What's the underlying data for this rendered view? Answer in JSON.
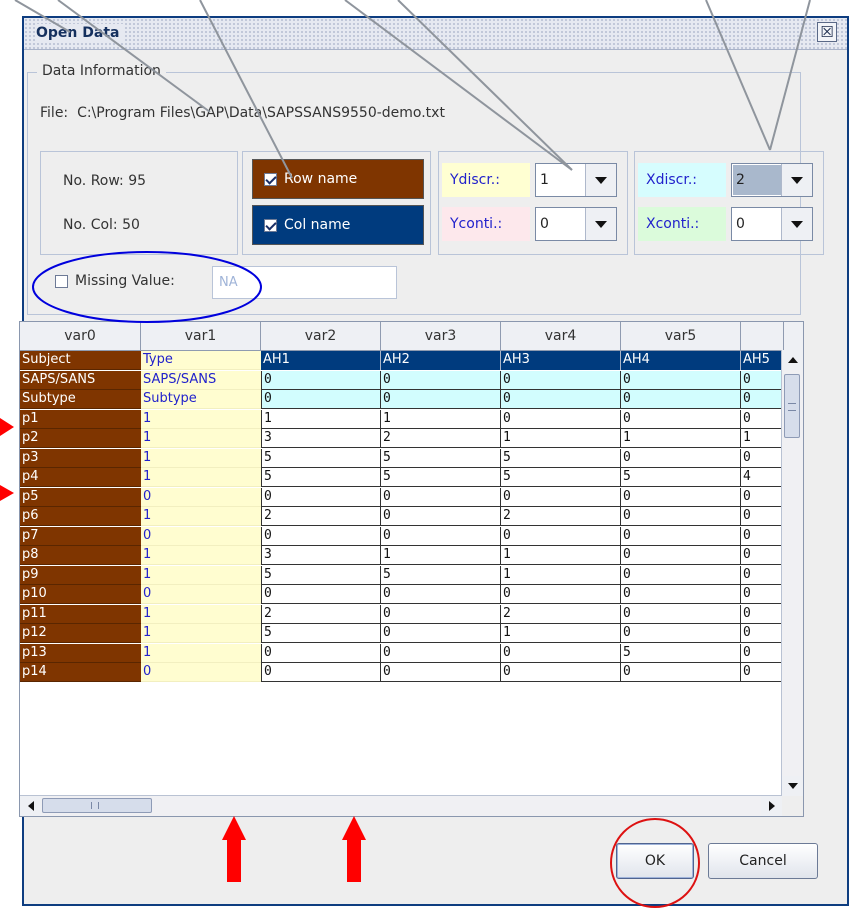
{
  "window": {
    "title": "Open Data",
    "close_glyph": "☒"
  },
  "info": {
    "group_label": "Data Information",
    "file_label": "File:",
    "file_path": "C:\\Program Files\\GAP\\Data\\SAPSSANS9550-demo.txt",
    "rows_text": "No. Row: 95",
    "cols_text": "No. Col:  50"
  },
  "checks": {
    "row_name": {
      "label": "Row name",
      "checked": true,
      "color": "#7f3500"
    },
    "col_name": {
      "label": "Col name",
      "checked": true,
      "color": "#003b7e"
    }
  },
  "combos": {
    "ydiscr": {
      "label": "Ydiscr.:",
      "value": "1",
      "label_color": "#2222cc",
      "bg": "#ffffd2"
    },
    "yconti": {
      "label": "Yconti.:",
      "value": "0",
      "label_color": "#2222cc",
      "bg": "#fde8ec"
    },
    "xdiscr": {
      "label": "Xdiscr.:",
      "value": "2",
      "label_color": "#2222cc",
      "bg": "#d6fdfe"
    },
    "xconti": {
      "label": "Xconti.:",
      "value": "0",
      "label_color": "#2222cc",
      "bg": "#dbfbdb"
    }
  },
  "missing": {
    "label": "Missing Value:",
    "checked": false,
    "placeholder": "NA"
  },
  "table": {
    "columns": [
      "var0",
      "var1",
      "var2",
      "var3",
      "var4",
      "var5",
      ""
    ],
    "rows": [
      [
        "Subject",
        "Type",
        "AH1",
        "AH2",
        "AH3",
        "AH4",
        "AH5"
      ],
      [
        "SAPS/SANS",
        "SAPS/SANS",
        "0",
        "0",
        "0",
        "0",
        "0"
      ],
      [
        "Subtype",
        "Subtype",
        "0",
        "0",
        "0",
        "0",
        "0"
      ],
      [
        "p1",
        "1",
        "1",
        "1",
        "0",
        "0",
        "0"
      ],
      [
        "p2",
        "1",
        "3",
        "2",
        "1",
        "1",
        "1"
      ],
      [
        "p3",
        "1",
        "5",
        "5",
        "5",
        "0",
        "0"
      ],
      [
        "p4",
        "1",
        "5",
        "5",
        "5",
        "5",
        "4"
      ],
      [
        "p5",
        "0",
        "0",
        "0",
        "0",
        "0",
        "0"
      ],
      [
        "p6",
        "1",
        "2",
        "0",
        "2",
        "0",
        "0"
      ],
      [
        "p7",
        "0",
        "0",
        "0",
        "0",
        "0",
        "0"
      ],
      [
        "p8",
        "1",
        "3",
        "1",
        "1",
        "0",
        "0"
      ],
      [
        "p9",
        "1",
        "5",
        "5",
        "1",
        "0",
        "0"
      ],
      [
        "p10",
        "0",
        "0",
        "0",
        "0",
        "0",
        "0"
      ],
      [
        "p11",
        "1",
        "2",
        "0",
        "2",
        "0",
        "0"
      ],
      [
        "p12",
        "1",
        "5",
        "0",
        "1",
        "0",
        "0"
      ],
      [
        "p13",
        "1",
        "0",
        "0",
        "0",
        "5",
        "0"
      ],
      [
        "p14",
        "0",
        "0",
        "0",
        "0",
        "0",
        "0"
      ]
    ]
  },
  "buttons": {
    "ok": "OK",
    "cancel": "Cancel"
  },
  "annotations": {
    "pointer_line_color": "#8f959d",
    "red_arrow_color": "#ff0000",
    "blue_ellipse_color": "#0000dd",
    "red_circle_color": "#dd1111"
  }
}
